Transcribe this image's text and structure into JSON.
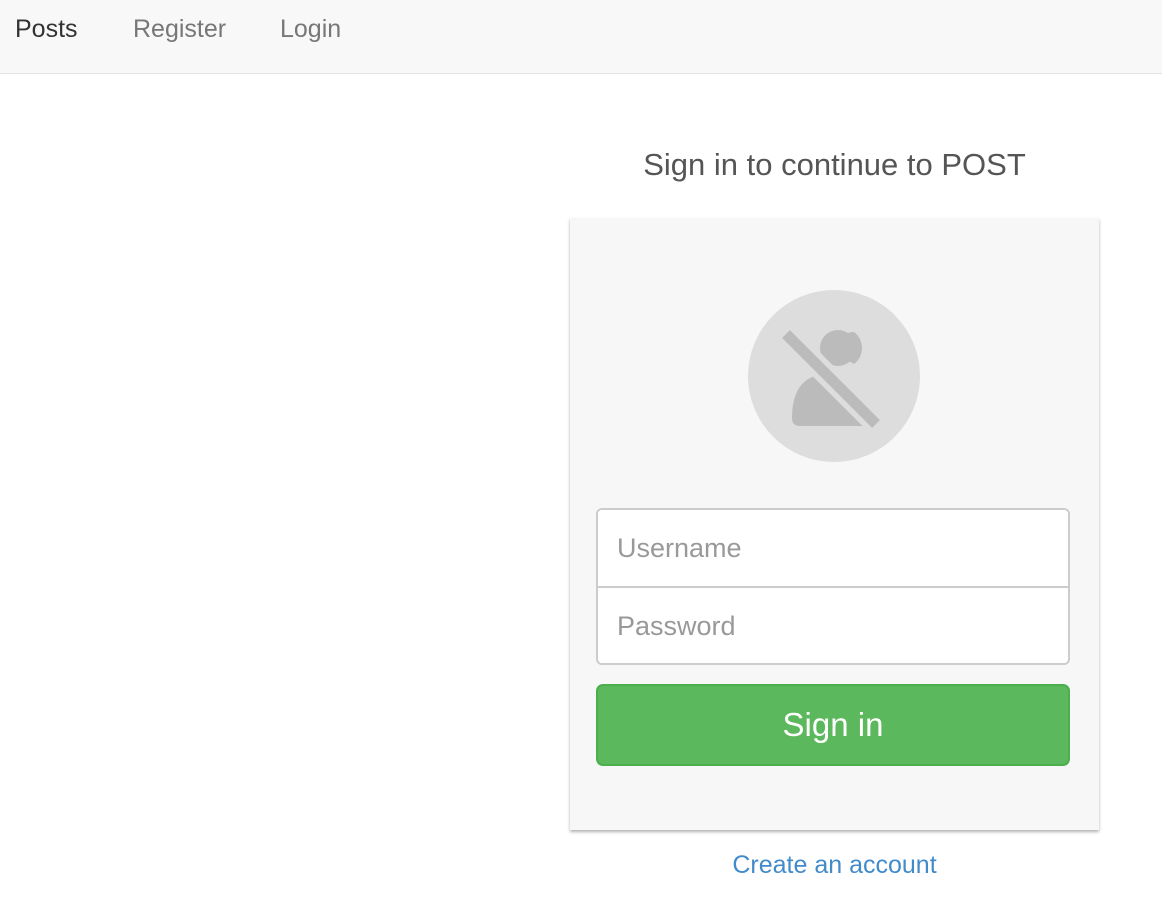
{
  "navbar": {
    "brand": "Posts",
    "links": [
      "Register",
      "Login"
    ]
  },
  "signin": {
    "heading": "Sign in to continue to POST",
    "avatar_icon": "user-slash-icon",
    "username_placeholder": "Username",
    "password_placeholder": "Password",
    "button_label": "Sign in",
    "create_account_label": "Create an account"
  },
  "colors": {
    "navbar_bg": "#f8f8f8",
    "card_bg": "#f7f7f7",
    "button_green": "#5cb85c",
    "link_blue": "#428bca",
    "avatar_bg": "#dddddd",
    "avatar_fg": "#bbbbbb"
  }
}
